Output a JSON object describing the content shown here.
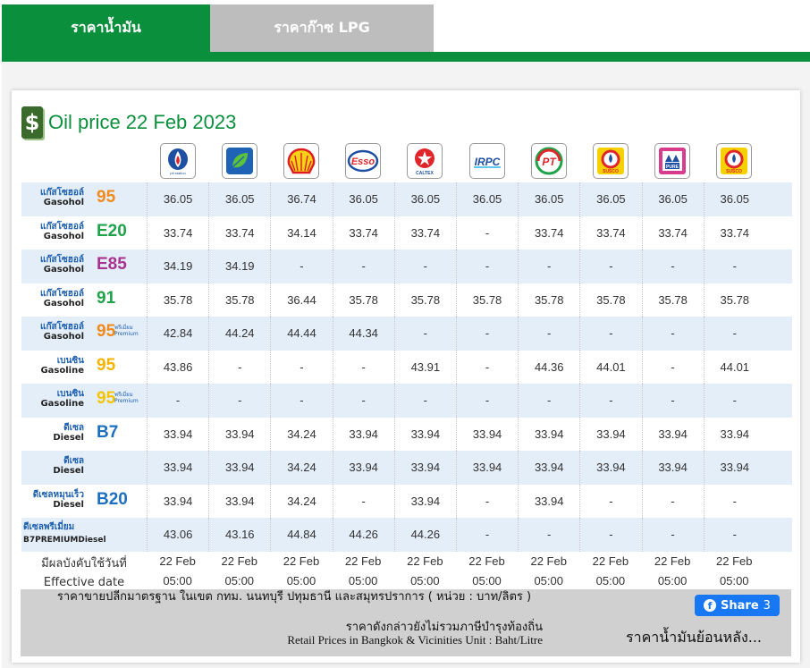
{
  "tabs": [
    {
      "label": "ราคาน้ำมัน"
    },
    {
      "label": "ราคาก๊าซ LPG"
    }
  ],
  "title": {
    "icon": "dollar-fuel-icon",
    "text": "Oil price 22 Feb 2023"
  },
  "stations": [
    {
      "name": "PTT",
      "icon": "ptt-logo-icon",
      "sub": "pttstation"
    },
    {
      "name": "Bangchak",
      "icon": "bangchak-logo-icon"
    },
    {
      "name": "Shell",
      "icon": "shell-logo-icon"
    },
    {
      "name": "Esso",
      "icon": "esso-logo-icon",
      "text": "Esso"
    },
    {
      "name": "Caltex",
      "icon": "caltex-logo-icon",
      "text": "CALTEX"
    },
    {
      "name": "IRPC",
      "icon": "irpc-logo-icon",
      "text": "IRPC"
    },
    {
      "name": "PT",
      "icon": "pt-logo-icon",
      "text": "PT"
    },
    {
      "name": "Susco",
      "icon": "susco-logo-icon",
      "text": "SUSCO"
    },
    {
      "name": "Pure",
      "icon": "pure-logo-icon",
      "text": "PURE"
    },
    {
      "name": "Susco Dealers",
      "icon": "susco-logo-icon",
      "text": "SUSCO"
    }
  ],
  "fuels": [
    {
      "th": "แก๊สโซฮอล์",
      "en": "Gasohol",
      "grade": "95",
      "color": "#f08a1c",
      "premium": "",
      "prices": [
        "36.05",
        "36.05",
        "36.74",
        "36.05",
        "36.05",
        "36.05",
        "36.05",
        "36.05",
        "36.05",
        "36.05"
      ]
    },
    {
      "th": "แก๊สโซฮอล์",
      "en": "Gasohol",
      "grade": "E20",
      "color": "#1fa34a",
      "premium": "",
      "prices": [
        "33.74",
        "33.74",
        "34.14",
        "33.74",
        "33.74",
        "-",
        "33.74",
        "33.74",
        "33.74",
        "33.74"
      ]
    },
    {
      "th": "แก๊สโซฮอล์",
      "en": "Gasohol",
      "grade": "E85",
      "color": "#a8328f",
      "premium": "",
      "prices": [
        "34.19",
        "34.19",
        "-",
        "-",
        "-",
        "-",
        "-",
        "-",
        "-",
        "-"
      ]
    },
    {
      "th": "แก๊สโซฮอล์",
      "en": "Gasohol",
      "grade": "91",
      "color": "#1fa34a",
      "premium": "",
      "prices": [
        "35.78",
        "35.78",
        "36.44",
        "35.78",
        "35.78",
        "35.78",
        "35.78",
        "35.78",
        "35.78",
        "35.78"
      ]
    },
    {
      "th": "แก๊สโซฮอล์",
      "en": "Gasohol",
      "grade": "95",
      "color": "#f08a1c",
      "premium": "พรีเมี่ยม Premium",
      "prices": [
        "42.84",
        "44.24",
        "44.44",
        "44.34",
        "-",
        "-",
        "-",
        "-",
        "-",
        "-"
      ]
    },
    {
      "th": "เบนซิน",
      "en": "Gasoline",
      "grade": "95",
      "color": "#f5b400",
      "premium": "",
      "prices": [
        "43.86",
        "-",
        "-",
        "-",
        "43.91",
        "-",
        "44.36",
        "44.01",
        "-",
        "44.01"
      ]
    },
    {
      "th": "เบนซิน",
      "en": "Gasoline",
      "grade": "95",
      "color": "#f5c400",
      "premium": "พรีเมี่ยม Premium",
      "prices": [
        "-",
        "-",
        "-",
        "-",
        "-",
        "-",
        "-",
        "-",
        "-",
        "-"
      ]
    },
    {
      "th": "ดีเซล",
      "en": "Diesel",
      "grade": "B7",
      "color": "#1d6fc0",
      "premium": "",
      "prices": [
        "33.94",
        "33.94",
        "34.24",
        "33.94",
        "33.94",
        "33.94",
        "33.94",
        "33.94",
        "33.94",
        "33.94"
      ]
    },
    {
      "th": "ดีเซล",
      "en": "Diesel",
      "grade": "",
      "color": "#1d6fc0",
      "premium": "",
      "prices": [
        "33.94",
        "33.94",
        "34.24",
        "33.94",
        "33.94",
        "33.94",
        "33.94",
        "33.94",
        "33.94",
        "33.94"
      ]
    },
    {
      "th": "ดีเซลหมุนเร็ว",
      "en": "Diesel",
      "grade": "B20",
      "color": "#1d6fc0",
      "premium": "",
      "prices": [
        "33.94",
        "33.94",
        "34.24",
        "-",
        "33.94",
        "-",
        "33.94",
        "-",
        "-",
        "-"
      ]
    },
    {
      "th": "ดีเซลพรีเมี่ยม",
      "en": "B7PREMIUMDiesel",
      "grade": "",
      "color": "#1d6fc0",
      "premium": "",
      "prices": [
        "43.06",
        "43.16",
        "44.84",
        "44.26",
        "44.26",
        "-",
        "-",
        "-",
        "-",
        "-"
      ]
    }
  ],
  "effective": {
    "label_th": "มีผลบังคับใช้วันที่",
    "label_en": "Effective date",
    "date": "22 Feb",
    "time": "05:00"
  },
  "footer": {
    "line1": "ราคาขายปลีกมาตรฐาน ในเขต กทม. นนทบุรี ปทุมธานี และสมุทรปราการ ( หน่วย : บาท/ลิตร )",
    "line2": "ราคาดังกล่าวยังไม่รวมภาษีบำรุงท้องถิ่น",
    "line3": "Retail Prices in Bangkok & Vicinities Unit : Baht/Litre",
    "share_label": "Share",
    "share_count": "3",
    "history_link": "ราคาน้ำมันย้อนหลัง..."
  }
}
